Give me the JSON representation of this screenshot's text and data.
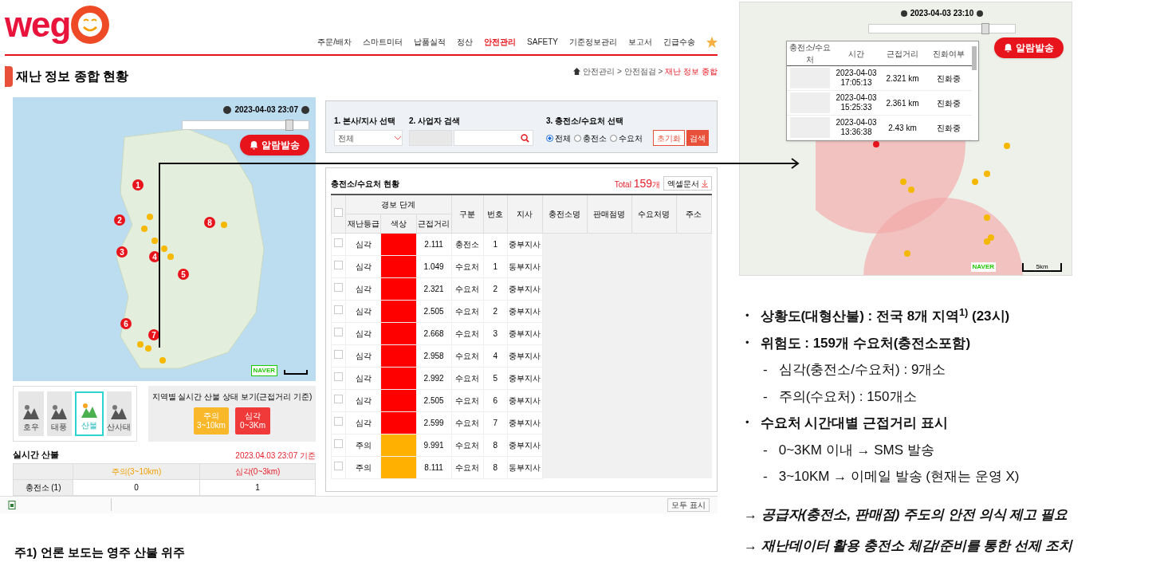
{
  "app": {
    "logo": "weg",
    "nav": [
      {
        "label": "주문/배차",
        "selected": false
      },
      {
        "label": "스마트미터",
        "selected": false
      },
      {
        "label": "납품실적",
        "selected": false
      },
      {
        "label": "정산",
        "selected": false
      },
      {
        "label": "안전관리",
        "selected": true
      },
      {
        "label": "SAFETY",
        "selected": false
      },
      {
        "label": "기준정보관리",
        "selected": false
      },
      {
        "label": "보고서",
        "selected": false
      },
      {
        "label": "긴급수송",
        "selected": false
      }
    ],
    "breadcrumb": [
      {
        "label": "안전관리 >",
        "selected": false
      },
      {
        "label": "안전점검 >",
        "selected": false
      },
      {
        "label": "재난 정보 종합",
        "selected": true
      }
    ],
    "page_title": "재난 정보 종합 현황",
    "map": {
      "datetime": "2023-04-03 23:07",
      "alert_button": "알람발송",
      "slider": {
        "level": 0.85
      },
      "markers": [
        "1",
        "2",
        "3",
        "4",
        "5",
        "6",
        "7",
        "8"
      ],
      "logo": "NAVER"
    },
    "disaster_tabs": [
      {
        "label": "호우",
        "selected": false
      },
      {
        "label": "태풍",
        "selected": false
      },
      {
        "label": "산불",
        "selected": true
      },
      {
        "label": "산사태",
        "selected": false
      }
    ],
    "region_panel": {
      "title": "지역별 실시간 산불 상태 보기(근접거리 기준)",
      "buttons": [
        {
          "kind": "caution",
          "label": "주의",
          "range": "3~10km"
        },
        {
          "kind": "severe",
          "label": "심각",
          "range": "0~3Km"
        }
      ]
    },
    "realtime": {
      "title": "실시간 산불",
      "timestamp": "2023.04.03 23:07 기준",
      "columns": [
        {
          "kind": "caution",
          "label": "주의(3~10km)"
        },
        {
          "kind": "severe",
          "label": "심각(0~3km)"
        }
      ],
      "rows": [
        {
          "label": "충전소 (1)",
          "values": [
            "0",
            "1"
          ]
        }
      ]
    },
    "filter": {
      "branch_label": "1. 본사/지사 선택",
      "branch_value": "전체",
      "search_label": "2. 사업자 검색",
      "type_label": "3. 충전소/수요처 선택",
      "types": [
        {
          "label": "전체",
          "selected": true
        },
        {
          "label": "충전소",
          "selected": false
        },
        {
          "label": "수요처",
          "selected": false
        }
      ],
      "reset_button": "초기화",
      "search_button": "검색"
    },
    "table": {
      "title": "충전소/수요처 현황",
      "total_label": "Total",
      "total_count": "159",
      "total_unit": "개",
      "excel_button": "엑셀문서",
      "header_checked": false,
      "group_header": "경보 단계",
      "sub_columns": [
        "재난등급",
        "색상",
        "근접거리"
      ],
      "columns": [
        "구분",
        "번호",
        "지사",
        "충전소명",
        "판매점명",
        "수요처명",
        "주소"
      ],
      "rows": [
        {
          "grade": "심각",
          "color": "#ff0000",
          "distance": "2.111",
          "type": "충전소",
          "no": "1",
          "branch": "중부지사",
          "checked": false
        },
        {
          "grade": "심각",
          "color": "#ff0000",
          "distance": "1.049",
          "type": "수요처",
          "no": "1",
          "branch": "동부지사",
          "checked": false
        },
        {
          "grade": "심각",
          "color": "#ff0000",
          "distance": "2.321",
          "type": "수요처",
          "no": "2",
          "branch": "중부지사",
          "checked": false
        },
        {
          "grade": "심각",
          "color": "#ff0000",
          "distance": "2.505",
          "type": "수요처",
          "no": "2",
          "branch": "중부지사",
          "checked": false
        },
        {
          "grade": "심각",
          "color": "#ff0000",
          "distance": "2.668",
          "type": "수요처",
          "no": "3",
          "branch": "중부지사",
          "checked": false
        },
        {
          "grade": "심각",
          "color": "#ff0000",
          "distance": "2.958",
          "type": "수요처",
          "no": "4",
          "branch": "중부지사",
          "checked": false
        },
        {
          "grade": "심각",
          "color": "#ff0000",
          "distance": "2.992",
          "type": "수요처",
          "no": "5",
          "branch": "중부지사",
          "checked": false
        },
        {
          "grade": "심각",
          "color": "#ff0000",
          "distance": "2.505",
          "type": "수요처",
          "no": "6",
          "branch": "중부지사",
          "checked": false
        },
        {
          "grade": "심각",
          "color": "#ff0000",
          "distance": "2.599",
          "type": "수요처",
          "no": "7",
          "branch": "중부지사",
          "checked": false
        },
        {
          "grade": "주의",
          "color": "#ffb000",
          "distance": "9.991",
          "type": "수요처",
          "no": "8",
          "branch": "중부지사",
          "checked": false
        },
        {
          "grade": "주의",
          "color": "#ffb000",
          "distance": "8.111",
          "type": "수요처",
          "no": "8",
          "branch": "동부지사",
          "checked": false
        }
      ]
    },
    "download_bar": {
      "show_all": "모두 표시"
    }
  },
  "zoom_map": {
    "datetime": "2023-04-03 23:10",
    "alert_button": "알람발송",
    "slider": {
      "level": 0.8
    },
    "logo": "NAVER",
    "scale": "5km",
    "popup": {
      "columns": [
        "충전소/수요처",
        "시간",
        "근접거리",
        "진화여부"
      ],
      "rows": [
        {
          "date": "2023-04-03",
          "time": "17:05:13",
          "distance": "2.321 km",
          "status": "진화중"
        },
        {
          "date": "2023-04-03",
          "time": "15:25:33",
          "distance": "2.361 km",
          "status": "진화중"
        },
        {
          "date": "2023-04-03",
          "time": "13:36:38",
          "distance": "2.43 km",
          "status": "진화중"
        }
      ]
    }
  },
  "summary": [
    {
      "marker": "•",
      "text": "상황도(대형산불) : 전국 8개 지역$^{1)}$ (23시)"
    },
    {
      "marker": "•",
      "text": "위험도 : 159개 수요처(충전소포함)",
      "children": [
        {
          "marker": "-",
          "text": "심각(충전소/수요처) : 9개소"
        },
        {
          "marker": "-",
          "text": "주의(수요처) : 150개소"
        }
      ]
    },
    {
      "marker": "•",
      "text": "수요처 시간대별 근접거리 표시",
      "children": [
        {
          "marker": "-",
          "text": "0~3KM 이내 → SMS 발송"
        },
        {
          "marker": "-",
          "text": "3~10KM → 이메일 발송 (현재는 운영 X)"
        }
      ]
    }
  ],
  "conclusions": [
    "→ 공급자(충전소, 판매점) 주도의 안전 의식 제고 필요",
    "→ 재난데이터 활용 충전소 체감/준비를 통한 선제 조치"
  ],
  "footnote": "주1) 언론 보도는 영주 산불 위주"
}
